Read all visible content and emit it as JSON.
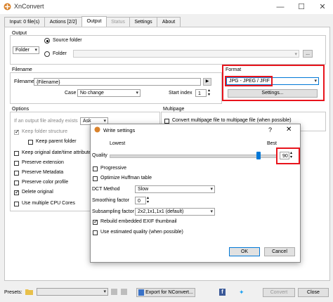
{
  "app": {
    "title": "XnConvert"
  },
  "window_controls": {
    "minimize": "—",
    "maximize": "☐",
    "close": "✕"
  },
  "tabs": [
    {
      "label": "Input: 0 file(s)"
    },
    {
      "label": "Actions [2/2]"
    },
    {
      "label": "Output"
    },
    {
      "label": "Status"
    },
    {
      "label": "Settings"
    },
    {
      "label": "About"
    }
  ],
  "output": {
    "section_label": "Output",
    "folder_select": "Folder",
    "source_folder_label": "Source folder",
    "folder_label": "Folder",
    "browse_label": "..."
  },
  "filename": {
    "section_label": "Filename",
    "label": "Filename",
    "value": "{Filename}",
    "case_label": "Case",
    "case_value": "No change",
    "start_index_label": "Start index",
    "start_index_value": "1"
  },
  "format": {
    "section_label": "Format",
    "value": "JPG - JPEG / JFIF",
    "settings_button": "Settings..."
  },
  "options": {
    "section_label": "Options",
    "if_exists_label": "If an output file already exists",
    "if_exists_value": "Ask",
    "keep_folder_structure": "Keep folder structure",
    "keep_parent_folder": "Keep parent folder",
    "keep_original_date": "Keep original date/time attribute",
    "preserve_extension": "Preserve extension",
    "preserve_metadata": "Preserve Metadata",
    "preserve_color_profile": "Preserve color profile",
    "delete_original": "Delete original",
    "use_multiple_cpu": "Use multiple CPU Cores"
  },
  "multipage": {
    "section_label": "Multipage",
    "convert_label": "Convert multipage file to multipage file (when possible)"
  },
  "dialog": {
    "title": "Write settings",
    "help": "?",
    "close": "✕",
    "lowest_label": "Lowest",
    "best_label": "Best",
    "quality_label": "Quality",
    "quality_value": "90",
    "quality_fraction": 0.9,
    "progressive": "Progressive",
    "optimize_huffman": "Optimize Huffman table",
    "dct_method_label": "DCT Method",
    "dct_method_value": "Slow",
    "smoothing_label": "Smoothing factor",
    "smoothing_value": "0",
    "subsampling_label": "Subsampling factor",
    "subsampling_value": "2x2,1x1,1x1 (default)",
    "rebuild_exif": "Rebuild embedded EXIF thumbnail",
    "use_estimated_quality": "Use estimated quality (when possible)",
    "ok": "OK",
    "cancel": "Cancel"
  },
  "bottom": {
    "presets_label": "Presets:",
    "export_button": "Export for NConvert...",
    "convert_button": "Convert",
    "close_button": "Close"
  },
  "colors": {
    "highlight_red": "#e8141c",
    "selection_blue": "#0078d7"
  }
}
